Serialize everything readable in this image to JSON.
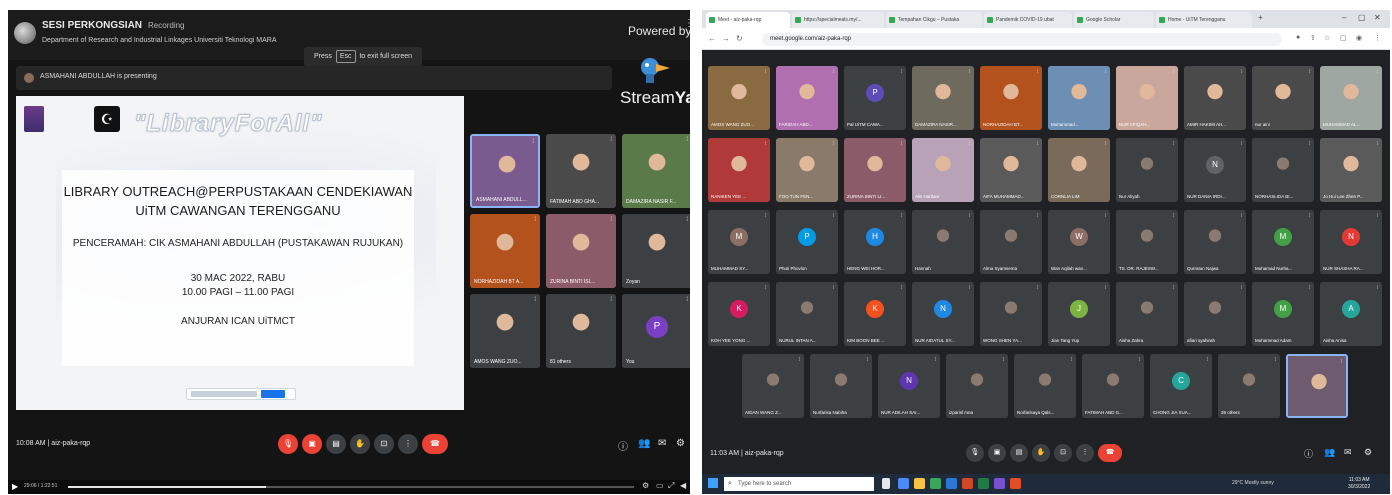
{
  "left": {
    "stream_title": "SESI PERKONGSIAN",
    "stream_recording": "Recording",
    "stream_subtitle": "Department of Research and Industrial Linkages Universiti Teknologi MARA",
    "esc_hint_pre": "Press",
    "esc_hint_key": "Esc",
    "esc_hint_post": "to exit full screen",
    "powered_by": "Powered by",
    "brand_stream": "Stream",
    "brand_yard": "Yard",
    "presenting": "ASMAHANI ABDULLAH is presenting",
    "slide": {
      "slogan": "\"LibraryForAll\"",
      "heading_line1": "LIBRARY OUTREACH@PERPUSTAKAAN CENDEKIAWAN",
      "heading_line2": "UiTM CAWANGAN TERENGGANU",
      "speaker": "PENCERAMAH: CIK ASMAHANI ABDULLAH (PUSTAKAWAN RUJUKAN)",
      "date": "30 MAC 2022, RABU",
      "time": "10.00 PAGI – 11.00 PAGI",
      "organizer": "ANJURAN ICAN UiTMCT"
    },
    "tiles": [
      {
        "name": "ASMAHANI ABDULL...",
        "initial": "",
        "color": "#7a5b8f",
        "active": true
      },
      {
        "name": "FATIMAH ABD GHA...",
        "initial": "",
        "color": "#4a4a4a"
      },
      {
        "name": "DAMAZIRA NASIR F...",
        "initial": "",
        "color": "#5a7a4a"
      },
      {
        "name": "NORHAZIDAH BT A...",
        "initial": "",
        "color": "#b4521e"
      },
      {
        "name": "ZURINA BINTI ISL...",
        "initial": "",
        "color": "#8c5b6a"
      },
      {
        "name": "Zoyan",
        "initial": "",
        "color": "#3c4043"
      },
      {
        "name": "AMOS WANG ZUO...",
        "initial": "",
        "color": "#3c4043"
      },
      {
        "name": "81 others",
        "initial": "",
        "color": "#3c4043"
      },
      {
        "name": "You",
        "initial": "P",
        "color": "#7b3fc4"
      }
    ],
    "time": "10:08 AM",
    "meeting_code": "aiz-paka-rqp",
    "video_time": "29:06 / 1:22:51",
    "video_progress": 0.35
  },
  "right": {
    "tabs": [
      "Meet - aiz-paka-rqp",
      "https://specialmeals.my/...",
      "Tempahan Cikgu – Pustaka",
      "Pandemik COVID-19 ubat",
      "Google Scholar",
      "Home - UiTM Terengganu"
    ],
    "url": "meet.google.com/aiz-paka-rqp",
    "tiles": [
      {
        "name": "AMOS WANG ZUO...",
        "initial": "",
        "color": "#8a6a40"
      },
      {
        "name": "FARIDAH ABD...",
        "initial": "",
        "color": "#b06fae"
      },
      {
        "name": "Pal UiTM CAWA...",
        "initial": "P",
        "color": "#5d4bb8"
      },
      {
        "name": "DAMAZIRA NASIR...",
        "initial": "",
        "color": "#6f6a5e"
      },
      {
        "name": "NORHAZIDAH BT...",
        "initial": "",
        "color": "#b4521e"
      },
      {
        "name": "Muhammad...",
        "initial": "",
        "color": "#6d8fb3"
      },
      {
        "name": "NUR AFIQAH...",
        "initial": "",
        "color": "#c9a79c"
      },
      {
        "name": "AMIR HAKIMI AH...",
        "initial": "",
        "color": "#4a4a4a"
      },
      {
        "name": "nur aini",
        "initial": "",
        "color": "#4a4a4a"
      },
      {
        "name": "MUHAMMAD AL...",
        "initial": "",
        "color": "#9ea7a1"
      },
      {
        "name": "NANIKEN YEE ...",
        "initial": "",
        "color": "#b03a3a"
      },
      {
        "name": "FOO TUN FEN...",
        "initial": "",
        "color": "#8a7a6a"
      },
      {
        "name": "ZURINA BINTI LI...",
        "initial": "",
        "color": "#8c5b6a"
      },
      {
        "name": "Alis Hartiani",
        "initial": "",
        "color": "#b8a2b8"
      },
      {
        "name": "AIFA MUHAMMAD...",
        "initial": "",
        "color": "#5a5a5a"
      },
      {
        "name": "CORNLIA LIM",
        "initial": "",
        "color": "#7a6a5a"
      },
      {
        "name": "Nur Aliyah",
        "initial": "",
        "color": "#3c4043"
      },
      {
        "name": "NUR DANIA IRDI...",
        "initial": "N",
        "color": "#5f6368"
      },
      {
        "name": "NORHASLIDA BI...",
        "initial": "",
        "color": "#3c4043"
      },
      {
        "name": "Jo Hui Lee Zhen P...",
        "initial": "",
        "color": "#5a5a5a"
      },
      {
        "name": "MUHAMMAD SY...",
        "initial": "M",
        "color": "#8d6e63"
      },
      {
        "name": "Phuti Phovlon",
        "initial": "P",
        "color": "#039be5"
      },
      {
        "name": "HENG WEI HOR...",
        "initial": "H",
        "color": "#1e88e5"
      },
      {
        "name": "Hannah",
        "initial": "",
        "color": "#3c4043"
      },
      {
        "name": "Alma Syamsema",
        "initial": "",
        "color": "#3c4043"
      },
      {
        "name": "Wan Aqilah wan...",
        "initial": "W",
        "color": "#8d6e63"
      },
      {
        "name": "TS. DR. RAJESW...",
        "initial": "",
        "color": "#3c4043"
      },
      {
        "name": "Qurratun Najwa",
        "initial": "",
        "color": "#3c4043"
      },
      {
        "name": "Muhamad Nurha...",
        "initial": "M",
        "color": "#43a047"
      },
      {
        "name": "NUR SHASHA RA...",
        "initial": "N",
        "color": "#e53935"
      },
      {
        "name": "KOH YEE YONG ...",
        "initial": "K",
        "color": "#d81b60"
      },
      {
        "name": "NURUL INTAN A...",
        "initial": "",
        "color": "#3c4043"
      },
      {
        "name": "KIM BOON BEE ...",
        "initial": "K",
        "color": "#f4511e"
      },
      {
        "name": "NUR AIDATUL SY...",
        "initial": "N",
        "color": "#1e88e5"
      },
      {
        "name": "WONG SHEN YA...",
        "initial": "",
        "color": "#3c4043"
      },
      {
        "name": "Jian Tang Yup",
        "initial": "J",
        "color": "#7cb342"
      },
      {
        "name": "Aisha Zahra",
        "initial": "",
        "color": "#3c4043"
      },
      {
        "name": "afiari syahirah",
        "initial": "",
        "color": "#3c4043"
      },
      {
        "name": "Muhammad Adam",
        "initial": "M",
        "color": "#43a047"
      },
      {
        "name": "Aisha Anisa",
        "initial": "A",
        "color": "#26a69a"
      },
      {
        "name": "AIDAN WANG Z...",
        "initial": "",
        "color": "#3c4043"
      },
      {
        "name": "Nurfarisa Nabiha",
        "initial": "",
        "color": "#3c4043"
      },
      {
        "name": "NUR ADILAH SAI...",
        "initial": "N",
        "color": "#5e35b1"
      },
      {
        "name": "izparisl mna",
        "initial": "",
        "color": "#3c4043"
      },
      {
        "name": "Norfarisaya Qals...",
        "initial": "",
        "color": "#3c4043"
      },
      {
        "name": "FATIMAH ABD G...",
        "initial": "",
        "color": "#3c4043"
      },
      {
        "name": "CHONG JIA XUA...",
        "initial": "C",
        "color": "#26a69a"
      },
      {
        "name": "39 others",
        "initial": "",
        "color": "#3c4043"
      },
      {
        "name": "",
        "initial": "",
        "color": "#6f5b6f",
        "active": true
      }
    ],
    "time": "11:03 AM",
    "meeting_code": "aiz-paka-rqp",
    "taskbar_search": "Type here to search",
    "weather": "29°C Mostly sunny",
    "clock_time": "11:03 AM",
    "clock_date": "30/3/2022"
  }
}
